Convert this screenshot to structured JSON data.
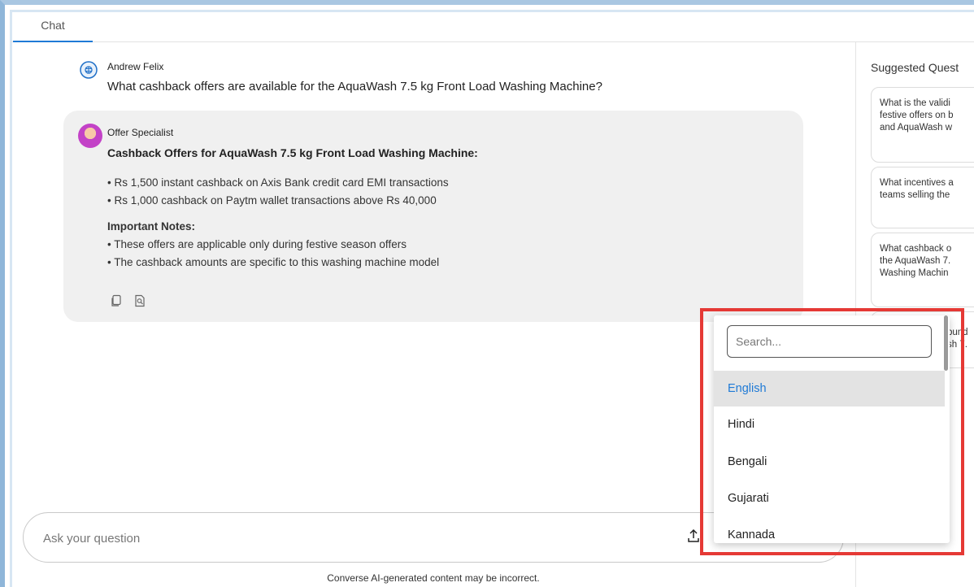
{
  "tabs": [
    {
      "label": "Chat"
    }
  ],
  "user_message": {
    "name": "Andrew Felix",
    "text": "What cashback offers are available for the AquaWash 7.5 kg Front Load Washing Machine?"
  },
  "assistant_message": {
    "name": "Offer Specialist",
    "title": "Cashback Offers for AquaWash 7.5 kg Front Load Washing Machine:",
    "offers": [
      "• Rs 1,500 instant cashback on Axis Bank credit card EMI transactions",
      "• Rs 1,000 cashback on Paytm wallet transactions above Rs 40,000"
    ],
    "notes_title": "Important Notes:",
    "notes": [
      "• These offers are applicable only during festive season offers",
      "• The cashback amounts are specific to this washing machine model"
    ]
  },
  "suggested": {
    "title": "Suggested Quest",
    "cards": [
      {
        "lines": [
          "What is the validi",
          "festive offers on b",
          "and AquaWash w"
        ]
      },
      {
        "lines": [
          "What incentives a",
          "teams selling the"
        ]
      },
      {
        "lines": [
          "What cashback o",
          "the AquaWash 7.",
          "Washing Machin"
        ]
      },
      {
        "lines": [
          "bund",
          "sh 7."
        ]
      }
    ]
  },
  "input": {
    "placeholder": "Ask your question",
    "value": ""
  },
  "disclaimer": "Converse AI-generated content may be incorrect.",
  "language_dropdown": {
    "search_placeholder": "Search...",
    "selected": "English",
    "options": [
      "English",
      "Hindi",
      "Bengali",
      "Gujarati",
      "Kannada"
    ]
  },
  "colors": {
    "accent": "#1f7ad6",
    "highlight_border": "#e53935",
    "bubble_bg": "#f0f0f0"
  },
  "icons": {
    "user_avatar": "brain-icon",
    "copy": "copy-icon",
    "source": "document-search-icon",
    "upload": "upload-icon"
  }
}
